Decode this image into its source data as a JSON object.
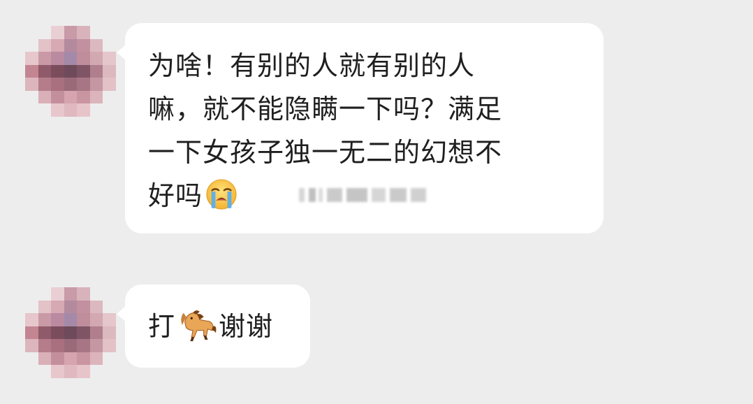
{
  "chat": {
    "messages": [
      {
        "lines": [
          "为啥！有别的人就有别的人",
          "嘛，就不能隐瞒一下吗？满足",
          "一下女孩子独一无二的幻想不",
          "好吗"
        ],
        "emoji": "loudly-crying-face"
      },
      {
        "text_before": "打",
        "emoji": "horse",
        "text_after": "谢谢"
      }
    ]
  },
  "colors": {
    "background": "#ededed",
    "bubble": "#ffffff",
    "text": "#1f1f1f"
  }
}
